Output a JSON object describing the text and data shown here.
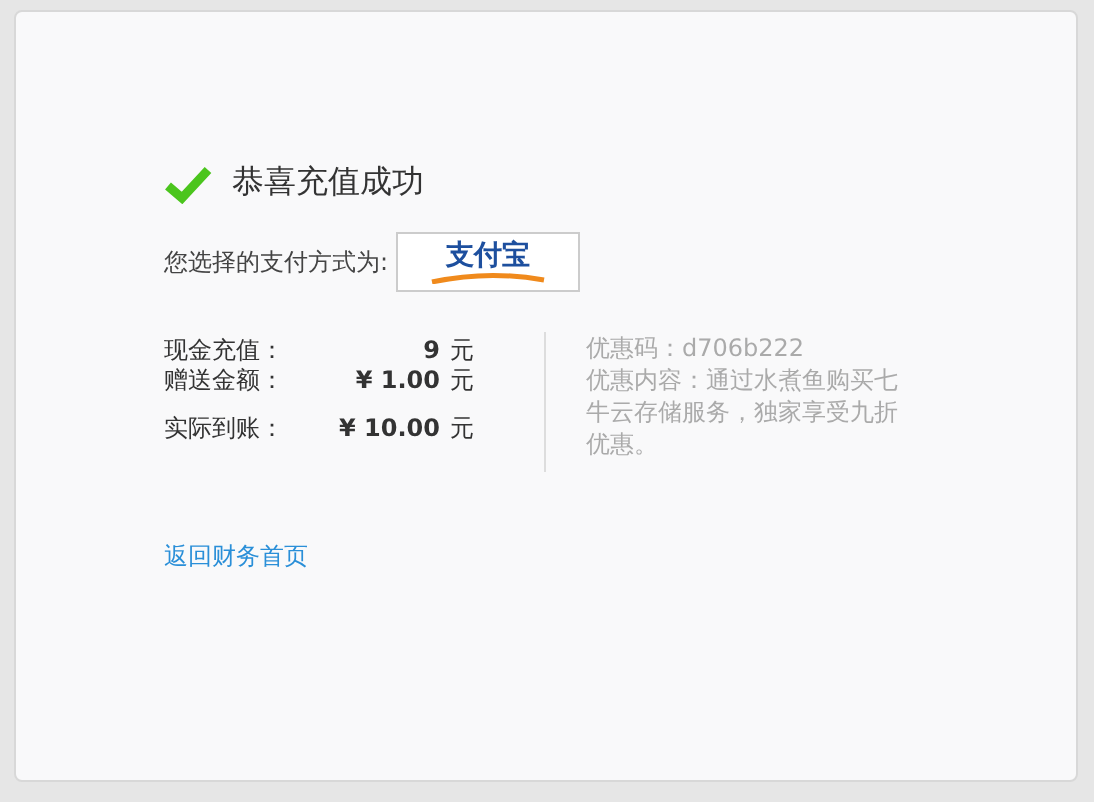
{
  "title": "恭喜充值成功",
  "payment": {
    "label": "您选择的支付方式为:",
    "logo_text": "支付宝"
  },
  "amounts": [
    {
      "label": "现金充值：",
      "value": "9",
      "unit": "元"
    },
    {
      "label": "赠送金额：",
      "value": "¥ 1.00",
      "unit": "元"
    },
    {
      "label": "实际到账：",
      "value": "¥ 10.00",
      "unit": "元"
    }
  ],
  "promo": {
    "code": "优惠码：d706b222",
    "content": "优惠内容：通过水煮鱼购买七牛云存储服务，独家享受九折优惠。"
  },
  "back_link": "返回财务首页"
}
